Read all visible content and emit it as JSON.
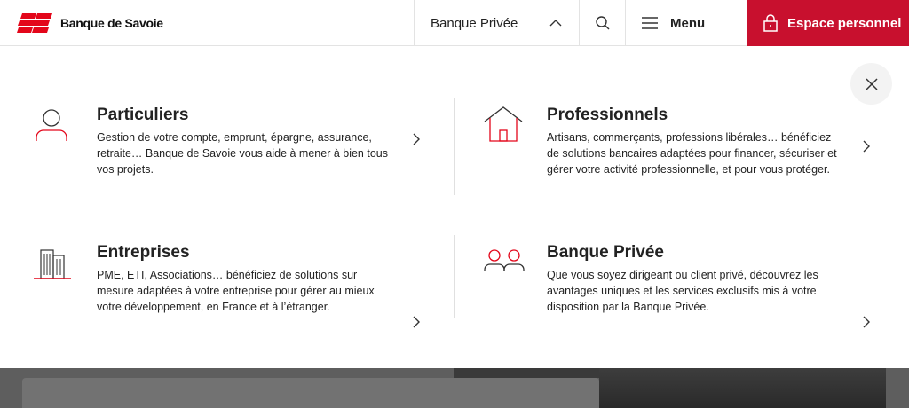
{
  "header": {
    "brand": "Banque de Savoie",
    "section_label": "Banque Privée",
    "menu_label": "Menu",
    "espace_label": "Espace personnel"
  },
  "cards": [
    {
      "title": "Particuliers",
      "description": "Gestion de votre compte, emprunt, épargne, assurance, retraite… Banque de Savoie vous aide à mener à bien tous vos projets.",
      "icon": "person-icon"
    },
    {
      "title": "Professionnels",
      "description": "Artisans, commerçants, professions libérales… bénéficiez de solutions bancaires adaptées pour financer, sécuriser et gérer votre activité professionnelle, et pour vous protéger.",
      "icon": "house-icon"
    },
    {
      "title": "Entreprises",
      "description": "PME, ETI, Associations… bénéficiez de solutions sur mesure adaptées à votre entreprise pour gérer au mieux votre développement, en France et à l’étranger.",
      "icon": "building-icon"
    },
    {
      "title": "Banque Privée",
      "description": "Que vous soyez dirigeant ou client privé, découvrez les avantages uniques et les services exclusifs mis à votre disposition par la Banque Privée.",
      "icon": "two-persons-icon"
    }
  ],
  "colors": {
    "brand_red": "#c8102e",
    "text": "#222222"
  }
}
